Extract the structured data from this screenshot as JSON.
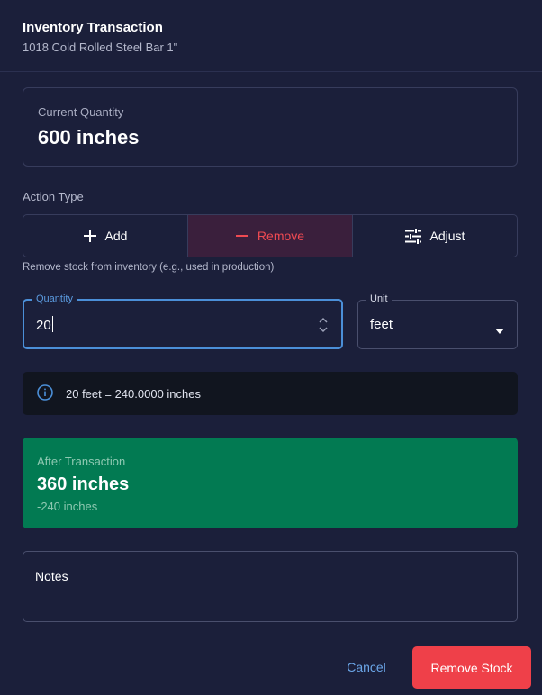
{
  "dialog": {
    "title": "Inventory Transaction",
    "subtitle": "1018 Cold Rolled Steel Bar 1\""
  },
  "current_quantity": {
    "label": "Current Quantity",
    "value": "600 inches"
  },
  "action": {
    "label": "Action Type",
    "options": [
      {
        "label": "Add",
        "icon": "plus-icon"
      },
      {
        "label": "Remove",
        "icon": "minus-icon",
        "selected": true
      },
      {
        "label": "Adjust",
        "icon": "sliders-icon"
      }
    ],
    "hint": "Remove stock from inventory (e.g., used in production)"
  },
  "quantity_field": {
    "label": "Quantity",
    "value": "20"
  },
  "unit_field": {
    "label": "Unit",
    "value": "feet"
  },
  "conversion": {
    "icon": "info-icon",
    "text": "20 feet = 240.0000 inches"
  },
  "after_transaction": {
    "label": "After Transaction",
    "value": "360 inches",
    "delta": "-240 inches"
  },
  "notes": {
    "label": "Notes"
  },
  "footer": {
    "cancel_label": "Cancel",
    "submit_label": "Remove Stock"
  },
  "colors": {
    "background": "#1b1f3a",
    "accent_red": "#ef4049",
    "accent_blue": "#4b8fd8",
    "success_green": "#027a52"
  }
}
